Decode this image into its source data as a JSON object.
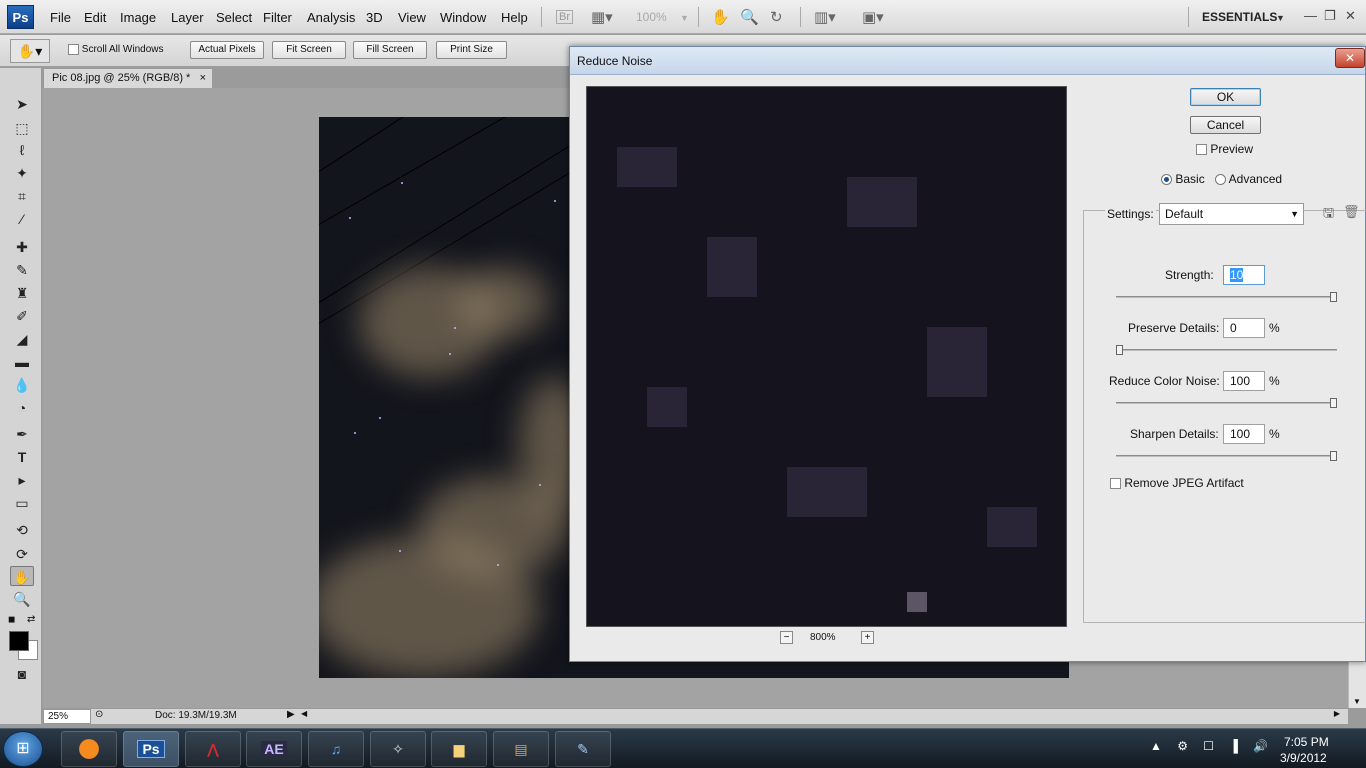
{
  "app": {
    "logo": "Ps"
  },
  "menu": [
    "File",
    "Edit",
    "Image",
    "Layer",
    "Select",
    "Filter",
    "Analysis",
    "3D",
    "View",
    "Window",
    "Help"
  ],
  "menubar": {
    "zoom": "100%",
    "workspace": "ESSENTIALS"
  },
  "options": {
    "scroll_all": "Scroll All Windows",
    "actual_pixels": "Actual Pixels",
    "fit_screen": "Fit Screen",
    "fill_screen": "Fill Screen",
    "print_size": "Print Size"
  },
  "document": {
    "tab": "Pic 08.jpg @ 25% (RGB/8) *",
    "close": "×"
  },
  "status": {
    "zoom": "25%",
    "doc_size": "Doc: 19.3M/19.3M"
  },
  "dialog": {
    "title": "Reduce Noise",
    "close": "✕",
    "ok": "OK",
    "cancel": "Cancel",
    "preview": "Preview",
    "basic": "Basic",
    "advanced": "Advanced",
    "preview_zoom": "800%",
    "settings_label": "Settings:",
    "settings_value": "Default",
    "strength_label": "Strength:",
    "strength_value": "10",
    "preserve_label": "Preserve Details:",
    "preserve_value": "0",
    "color_noise_label": "Reduce Color Noise:",
    "color_noise_value": "100",
    "sharpen_label": "Sharpen Details:",
    "sharpen_value": "100",
    "percent": "%",
    "remove_jpeg": "Remove JPEG Artifact",
    "sliders": {
      "strength": 1.0,
      "preserve": 0.0,
      "color_noise": 1.0,
      "sharpen": 1.0
    }
  },
  "taskbar": {
    "apps": [
      "firefox",
      "Ps",
      "acrobat",
      "AE",
      "itunes",
      "skyrim",
      "explorer",
      "video",
      "paint"
    ],
    "labels": {
      "ps": "Ps",
      "ae": "AE"
    },
    "time": "7:05 PM",
    "date": "3/9/2012"
  }
}
